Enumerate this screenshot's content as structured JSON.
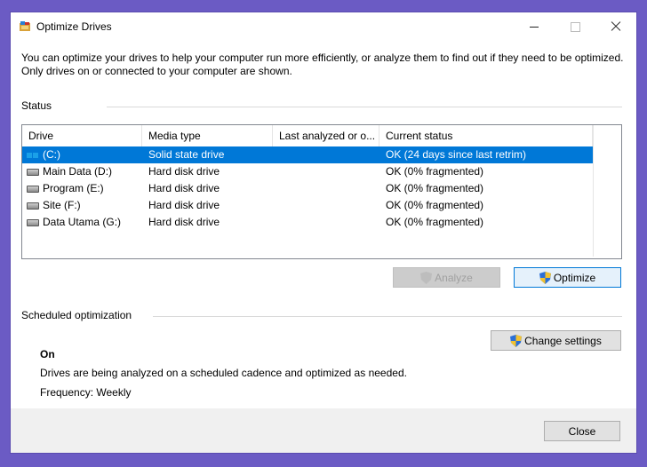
{
  "window": {
    "title": "Optimize Drives"
  },
  "description": "You can optimize your drives to help your computer run more efficiently, or analyze them to find out if they need to be optimized. Only drives on or connected to your computer are shown.",
  "status": {
    "label": "Status",
    "columns": [
      "Drive",
      "Media type",
      "Last analyzed or o...",
      "Current status"
    ],
    "drives": [
      {
        "icon": "ssd-drive-icon",
        "name": "(C:)",
        "media": "Solid state drive",
        "last": "",
        "status": "OK (24 days since last retrim)",
        "selected": true
      },
      {
        "icon": "hard-disk-icon",
        "name": "Main Data (D:)",
        "media": "Hard disk drive",
        "last": "",
        "status": "OK (0% fragmented)",
        "selected": false
      },
      {
        "icon": "hard-disk-icon",
        "name": "Program (E:)",
        "media": "Hard disk drive",
        "last": "",
        "status": "OK (0% fragmented)",
        "selected": false
      },
      {
        "icon": "hard-disk-icon",
        "name": "Site (F:)",
        "media": "Hard disk drive",
        "last": "",
        "status": "OK (0% fragmented)",
        "selected": false
      },
      {
        "icon": "hard-disk-icon",
        "name": "Data Utama (G:)",
        "media": "Hard disk drive",
        "last": "",
        "status": "OK (0% fragmented)",
        "selected": false
      }
    ],
    "analyze_label": "Analyze",
    "optimize_label": "Optimize"
  },
  "scheduled": {
    "label": "Scheduled optimization",
    "state": "On",
    "description": "Drives are being analyzed on a scheduled cadence and optimized as needed.",
    "frequency": "Frequency: Weekly",
    "change_label": "Change settings"
  },
  "footer": {
    "close_label": "Close"
  },
  "colors": {
    "accent": "#0078d7",
    "desktop": "#6b5bc4"
  }
}
